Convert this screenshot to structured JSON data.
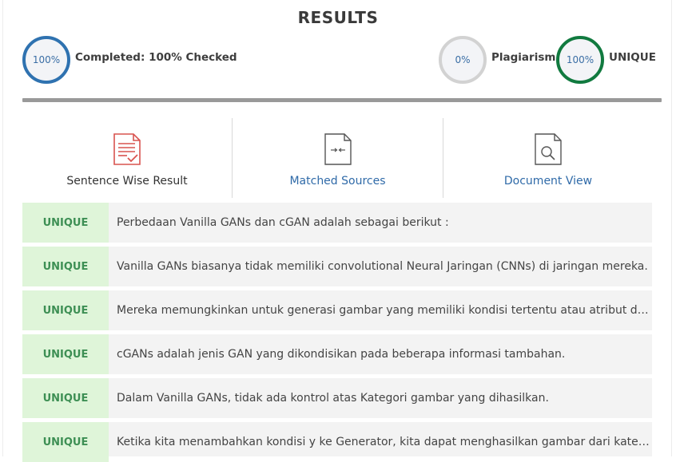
{
  "header": {
    "title": "RESULTS"
  },
  "summary": {
    "completed": {
      "ring_value": "100%",
      "label": "Completed: 100% Checked",
      "progress": 100
    },
    "plagiarism": {
      "ring_value": "0%",
      "label": "Plagiarism",
      "percent": 0
    },
    "unique": {
      "ring_value": "100%",
      "label": "UNIQUE",
      "percent": 100
    }
  },
  "colors": {
    "completed_ring": "#2f72b0",
    "plagiarism_ring": "#d2d2d2",
    "unique_ring": "#117a3f",
    "unique_badge_bg": "#dff5d9",
    "unique_badge_text": "#3d8f54",
    "link": "#2f6aa8",
    "icon_red": "#d9534f"
  },
  "tabs": [
    {
      "label": "Sentence Wise Result",
      "icon": "document-check-icon",
      "active": true
    },
    {
      "label": "Matched Sources",
      "icon": "document-compare-icon",
      "active": false
    },
    {
      "label": "Document View",
      "icon": "document-search-icon",
      "active": false
    }
  ],
  "results": [
    {
      "status": "UNIQUE",
      "sentence": "Perbedaan Vanilla GANs dan cGAN adalah sebagai berikut :"
    },
    {
      "status": "UNIQUE",
      "sentence": "Vanilla GANs biasanya tidak memiliki convolutional Neural Jaringan (CNNs) di jaringan mereka."
    },
    {
      "status": "UNIQUE",
      "sentence": "Mereka memungkinkan untuk generasi gambar yang memiliki kondisi tertentu atau atribut dan telah t..."
    },
    {
      "status": "UNIQUE",
      "sentence": "cGANs adalah jenis GAN yang dikondisikan pada beberapa informasi tambahan."
    },
    {
      "status": "UNIQUE",
      "sentence": "Dalam Vanilla GANs, tidak ada kontrol atas Kategori gambar yang dihasilkan."
    },
    {
      "status": "UNIQUE",
      "sentence": "Ketika kita menambahkan kondisi y ke Generator, kita dapat menghasilkan gambar dari kategori terte..."
    }
  ]
}
